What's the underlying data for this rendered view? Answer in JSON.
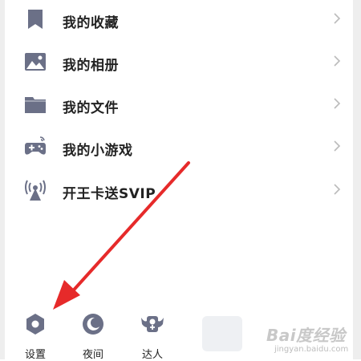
{
  "menu": {
    "items": [
      {
        "label": "我的收藏",
        "icon": "bookmark-icon"
      },
      {
        "label": "我的相册",
        "icon": "image-icon"
      },
      {
        "label": "我的文件",
        "icon": "folder-icon"
      },
      {
        "label": "我的小游戏",
        "icon": "gamepad-icon"
      },
      {
        "label": "开王卡送SVIP",
        "icon": "broadcast-tower-icon"
      }
    ]
  },
  "bottom_bar": {
    "tabs": [
      {
        "label": "设置",
        "icon": "settings-icon"
      },
      {
        "label": "夜间",
        "icon": "moon-icon"
      },
      {
        "label": "达人",
        "icon": "talent-badge-icon"
      }
    ]
  },
  "watermark": {
    "main": "Bai度经验",
    "sub": "jingyan.baidu.com"
  },
  "colors": {
    "icon": "#6b7087",
    "text": "#222222",
    "chevron": "#bbbbbb",
    "arrow": "#e62a2a",
    "edge": "#eeeeee"
  }
}
